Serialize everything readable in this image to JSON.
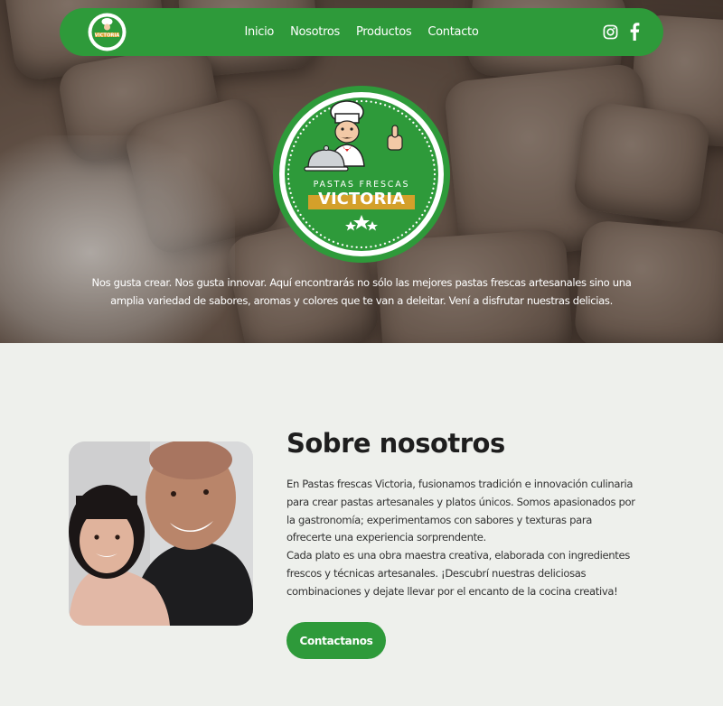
{
  "nav": {
    "links": [
      "Inicio",
      "Nosotros",
      "Productos",
      "Contacto"
    ],
    "social": [
      "instagram-icon",
      "facebook-icon"
    ]
  },
  "brand": {
    "logo_top": "PASTAS FRESCAS",
    "logo_name": "VICTORIA"
  },
  "hero": {
    "text": "Nos gusta crear. Nos gusta innovar. Aquí encontrarás no sólo las mejores pastas frescas artesanales sino una amplia variedad de sabores, aromas y colores que te van a deleitar. Vení a disfrutar nuestras delicias."
  },
  "about": {
    "title": "Sobre nosotros",
    "paragraph1": "En Pastas frescas Victoria, fusionamos tradición e innovación culinaria para crear pastas artesanales y platos únicos. Somos apasionados por la gastronomía; experimentamos con sabores y texturas para ofrecerte una experiencia sorprendente.",
    "paragraph2": "Cada plato es una obra maestra creativa, elaborada con ingredientes frescos y técnicas artesanales. ¡Descubrí nuestras deliciosas combinaciones y dejate llevar por el encanto de la cocina creativa!",
    "button": "Contactanos"
  },
  "colors": {
    "brand_green": "#2e9a3a",
    "background": "#eef0ec",
    "gold": "#d4a02a"
  }
}
